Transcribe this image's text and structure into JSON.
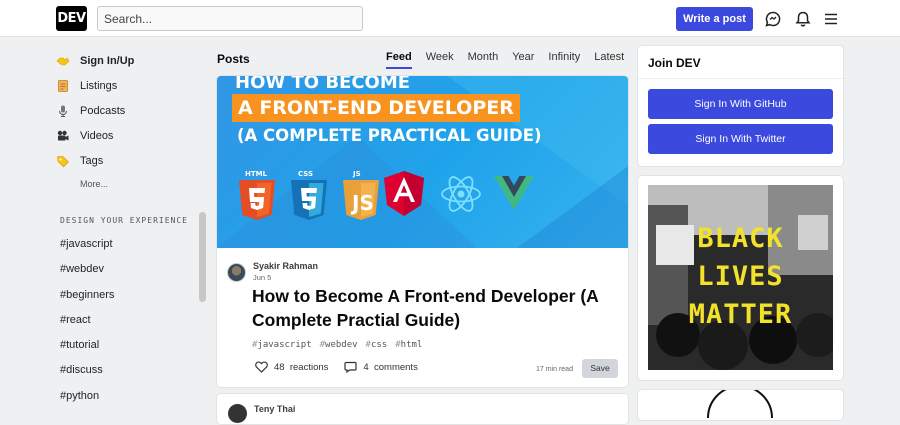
{
  "header": {
    "logo": "DEV",
    "search_placeholder": "Search...",
    "write_post": "Write a post",
    "icons": [
      "chat-icon",
      "bell-icon",
      "menu-icon"
    ]
  },
  "sidebar": {
    "items": [
      {
        "icon": "handshake-icon",
        "label": "Sign In/Up"
      },
      {
        "icon": "scroll-icon",
        "label": "Listings"
      },
      {
        "icon": "microphone-icon",
        "label": "Podcasts"
      },
      {
        "icon": "film-camera-icon",
        "label": "Videos"
      },
      {
        "icon": "tag-icon",
        "label": "Tags"
      }
    ],
    "more": "More...",
    "design_heading": "DESIGN YOUR EXPERIENCE",
    "tags": [
      "#javascript",
      "#webdev",
      "#beginners",
      "#react",
      "#tutorial",
      "#discuss",
      "#python"
    ]
  },
  "feed": {
    "title": "Posts",
    "tabs": [
      "Feed",
      "Week",
      "Month",
      "Year",
      "Infinity",
      "Latest"
    ],
    "active_tab": "Feed"
  },
  "post": {
    "cover": {
      "line1": "HOW TO BECOME",
      "line2": "A FRONT-END DEVELOPER",
      "line3": "(A COMPLETE PRACTICAL GUIDE)",
      "tech": [
        "HTML",
        "CSS",
        "JS"
      ]
    },
    "author": "Syakir Rahman",
    "date": "Jun 5",
    "title": "How to Become A Front-end Developer (A Complete Practial Guide)",
    "tags": [
      "javascript",
      "webdev",
      "css",
      "html"
    ],
    "reactions_count": "48",
    "reactions_label": "reactions",
    "comments_count": "4",
    "comments_label": "comments",
    "read_time": "17 min read",
    "save": "Save"
  },
  "next_post": {
    "author": "Teny Thai"
  },
  "join": {
    "title": "Join DEV",
    "github": "Sign In With GitHub",
    "twitter": "Sign In With Twitter"
  },
  "banner": {
    "lines": [
      "BLACK",
      "LIVES",
      "MATTER"
    ]
  },
  "colors": {
    "accent": "#3b49df",
    "banner_text": "#f2e22a",
    "cover_highlight": "#f7931e"
  }
}
